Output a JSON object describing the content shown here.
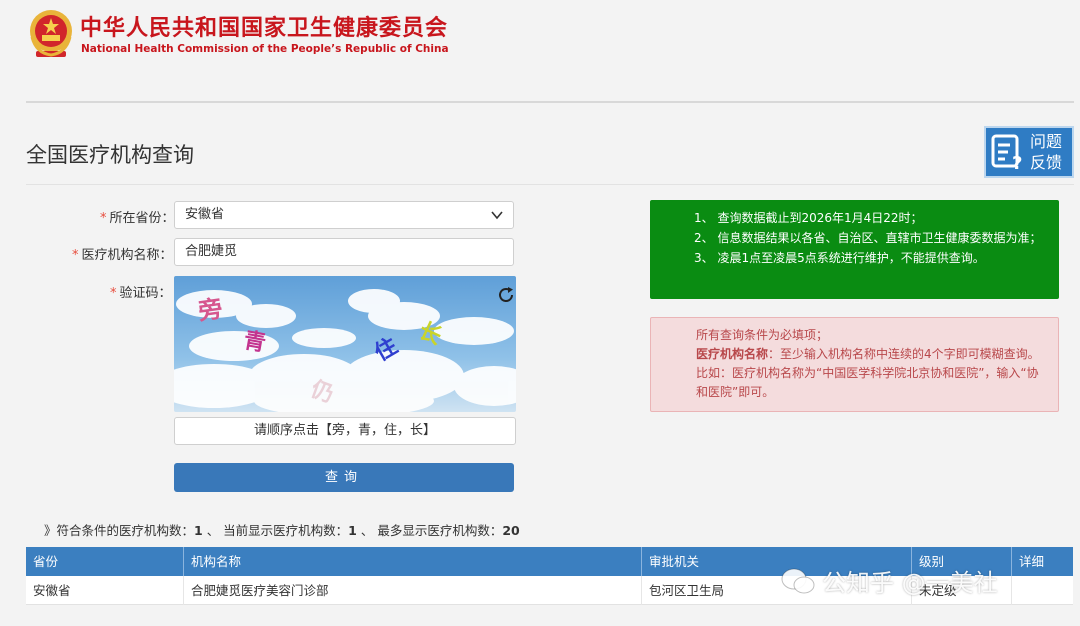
{
  "header": {
    "title_cn": "中华人民共和国国家卫生健康委员会",
    "title_en": "National Health Commission of the People’s Republic of China"
  },
  "page_title": "全国医疗机构查询",
  "feedback": {
    "label": "问题反馈",
    "icon": "feedback-icon"
  },
  "form": {
    "province_label": "所在省份：",
    "province_value": "安徽省",
    "name_label": "医疗机构名称：",
    "name_value": "合肥婕觅",
    "captcha_label": "验证码：",
    "captcha_chars": [
      "旁",
      "青",
      "住",
      "长",
      "仍"
    ],
    "captcha_hint": "请顺序点击【旁，青，住，长】",
    "submit_label": "查询",
    "required_mark": "*"
  },
  "notices": {
    "green": [
      "1、 查询数据截止到2026年1月4日22时；",
      "2、 信息数据结果以各省、自治区、直辖市卫生健康委数据为准；",
      "3、 凌晨1点至凌晨5点系统进行维护，不能提供查询。"
    ],
    "red_line1": "所有查询条件为必填项；",
    "red_bold": "医疗机构名称",
    "red_line2": "：至少输入机构名称中连续的4个字即可模糊查询。比如：医疗机构名称为“中国医学科学院北京协和医院”，输入“协和医院”即可。"
  },
  "summary": {
    "prefix": "》符合条件的医疗机构数：",
    "matched": "1",
    "mid": " 、 当前显示医疗机构数：",
    "shown": "1",
    "mid2": " 、 最多显示医疗机构数：",
    "max": "20"
  },
  "table": {
    "headers": [
      "省份",
      "机构名称",
      "审批机关",
      "级别",
      "详细"
    ],
    "rows": [
      [
        "安徽省",
        "合肥婕觅医疗美容门诊部",
        "包河区卫生局",
        "未定级",
        ""
      ]
    ]
  },
  "watermark": {
    "text": "公知乎 @一美社"
  },
  "colors": {
    "brand_red": "#c8161d",
    "primary_blue": "#3978b9",
    "notice_green": "#0a8c12",
    "notice_red": "#b8474a"
  }
}
